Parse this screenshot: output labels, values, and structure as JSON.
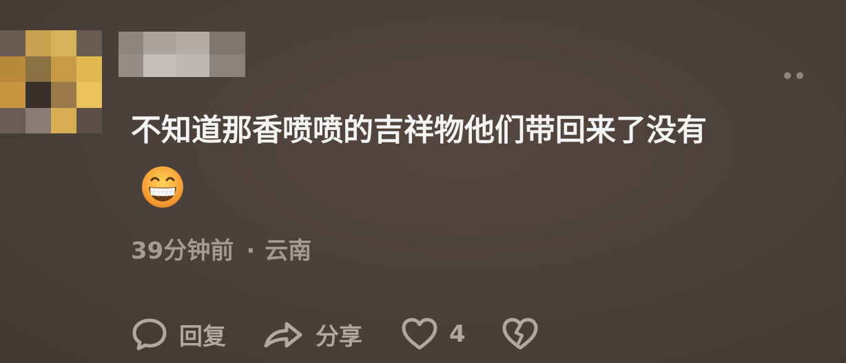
{
  "comment": {
    "text": "不知道那香喷喷的吉祥物他们带回来了没有",
    "emoji": "grinning-face-emoji",
    "time": "39分钟前",
    "separator": "·",
    "location": "云南"
  },
  "actions": {
    "reply_label": "回复",
    "share_label": "分享",
    "like_count": "4"
  },
  "icons": {
    "reply": "comment-bubble-icon",
    "share": "share-arrow-icon",
    "like": "heart-icon",
    "dislike": "broken-heart-icon",
    "more": "more-dots-icon"
  },
  "colors": {
    "background": "#4b403a",
    "text_primary": "#f4f4f4",
    "text_secondary": "#a39b96",
    "icon": "#b0a8a3"
  }
}
